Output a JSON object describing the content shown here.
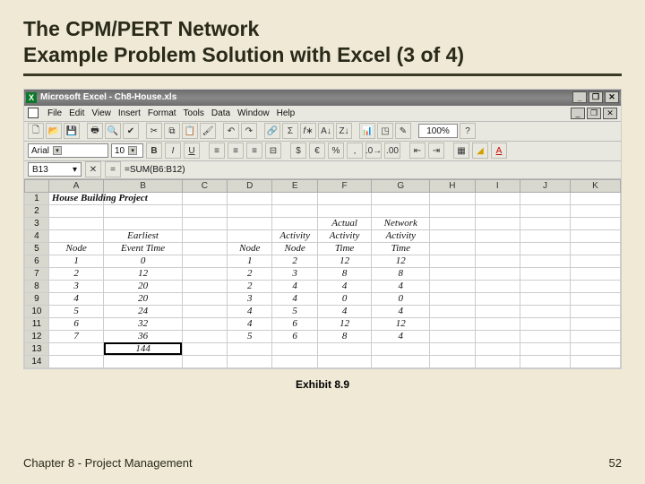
{
  "slide": {
    "title_line1": "The CPM/PERT Network",
    "title_line2": "Example Problem Solution with Excel (3 of 4)",
    "caption": "Exhibit 8.9",
    "footer_left": "Chapter 8 - Project Management",
    "footer_right": "52"
  },
  "excel": {
    "titlebar": "Microsoft Excel - Ch8-House.xls",
    "menus": [
      "File",
      "Edit",
      "View",
      "Insert",
      "Format",
      "Tools",
      "Data",
      "Window",
      "Help"
    ],
    "zoom": "100%",
    "font_name": "Arial",
    "font_size": "10",
    "name_box": "B13",
    "formula": "=SUM(B6:B12)",
    "columns": [
      "A",
      "B",
      "C",
      "D",
      "E",
      "F",
      "G",
      "H",
      "I",
      "J",
      "K"
    ],
    "project_title": "House Building Project",
    "headers": {
      "b_top": "Earliest",
      "b_bot": "Event Time",
      "a_bot": "Node",
      "d_bot": "Node",
      "e_top": "Activity",
      "e_bot": "Node",
      "f_top": "Actual",
      "f_mid": "Activity",
      "f_bot": "Time",
      "g_top": "Network",
      "g_mid": "Activity",
      "g_bot": "Time"
    },
    "rows": [
      {
        "r": "6",
        "a": "1",
        "b": "0",
        "d": "1",
        "e": "2",
        "f": "12",
        "g": "12"
      },
      {
        "r": "7",
        "a": "2",
        "b": "12",
        "d": "2",
        "e": "3",
        "f": "8",
        "g": "8"
      },
      {
        "r": "8",
        "a": "3",
        "b": "20",
        "d": "2",
        "e": "4",
        "f": "4",
        "g": "4"
      },
      {
        "r": "9",
        "a": "4",
        "b": "20",
        "d": "3",
        "e": "4",
        "f": "0",
        "g": "0"
      },
      {
        "r": "10",
        "a": "5",
        "b": "24",
        "d": "4",
        "e": "5",
        "f": "4",
        "g": "4"
      },
      {
        "r": "11",
        "a": "6",
        "b": "32",
        "d": "4",
        "e": "6",
        "f": "12",
        "g": "12"
      },
      {
        "r": "12",
        "a": "7",
        "b": "36",
        "d": "5",
        "e": "6",
        "f": "8",
        "g": "4"
      }
    ],
    "total_row": {
      "r": "13",
      "b": "144"
    },
    "row14": "14"
  }
}
